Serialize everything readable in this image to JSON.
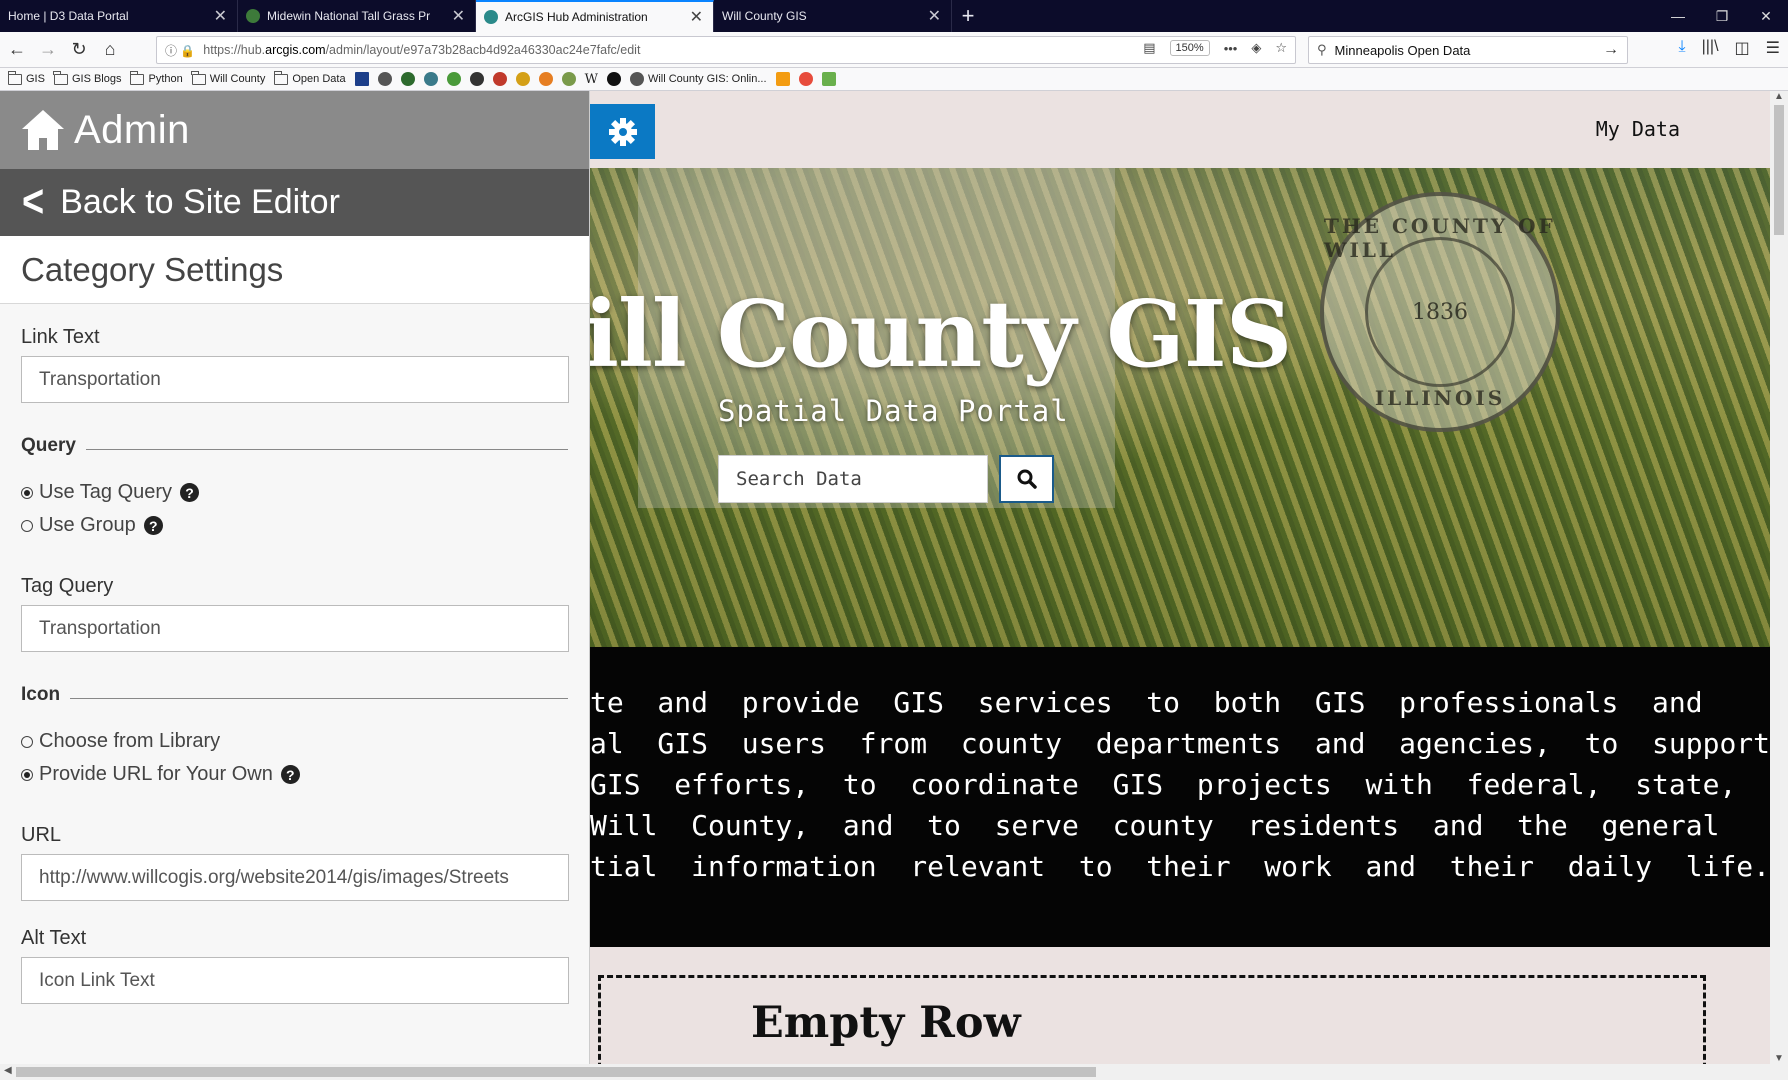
{
  "browser": {
    "tabs": [
      {
        "title": "Home | D3 Data Portal",
        "active": false
      },
      {
        "title": "Midewin National Tall Grass Pr",
        "active": false
      },
      {
        "title": "ArcGIS Hub Administration",
        "active": true
      },
      {
        "title": "Will County GIS",
        "active": false
      }
    ],
    "url_prefix": "https://hub.",
    "url_host": "arcgis.com",
    "url_path": "/admin/layout/e97a73b28acb4d92a46330ac24e7fafc/edit",
    "zoom": "150%",
    "search_value": "Minneapolis Open Data",
    "bookmarks": [
      "GIS",
      "GIS Blogs",
      "Python",
      "Will County",
      "Open Data"
    ],
    "bookmark_w": "W",
    "bookmark_last": "Will County GIS: Onlin..."
  },
  "panel": {
    "header_title": "Admin",
    "back_label": "Back to Site Editor",
    "section_title": "Category Settings",
    "link_text_label": "Link Text",
    "link_text_value": "Transportation",
    "query_section": "Query",
    "radio_tag_query": "Use Tag Query",
    "radio_group": "Use Group",
    "tag_query_label": "Tag Query",
    "tag_query_value": "Transportation",
    "icon_section": "Icon",
    "radio_library": "Choose from Library",
    "radio_url": "Provide URL for Your Own",
    "url_label": "URL",
    "url_value": "http://www.willcogis.org/website2014/gis/images/Streets",
    "alt_label": "Alt Text",
    "alt_placeholder": "Icon Link Text"
  },
  "preview": {
    "nav_link": "My Data",
    "hero_title": "ill County GIS",
    "hero_subtitle": "Spatial Data Portal",
    "search_placeholder": "Search Data",
    "seal_top": "THE COUNTY OF WILL",
    "seal_year": "1836",
    "seal_bottom": "ILLINOIS",
    "about_lines": [
      "te  and  provide  GIS  services  to  both  GIS  professionals  and",
      "al  GIS  users  from  county  departments  and  agencies,  to  support",
      "GIS  efforts,  to  coordinate  GIS  projects  with  federal,  state,",
      "Will  County,  and  to  serve  county  residents  and  the  general",
      "tial  information  relevant  to  their  work  and  their  daily  life."
    ],
    "empty_row_label": "Empty Row"
  },
  "colors": {
    "gear_button": "#0b79c4",
    "panel_header": "#8a8a8a",
    "back_bar": "#555555"
  }
}
